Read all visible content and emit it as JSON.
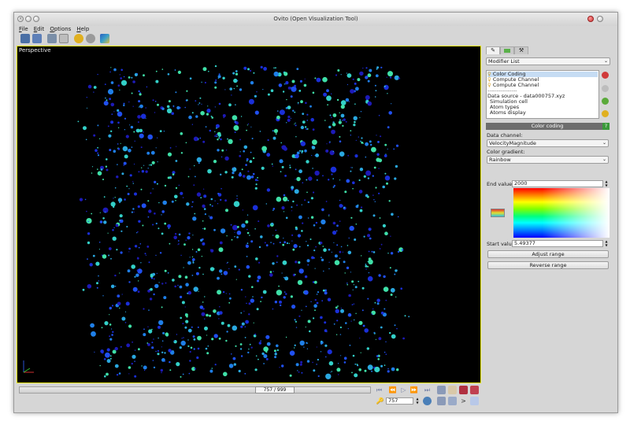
{
  "window": {
    "title": "Ovito (Open Visualization Tool)"
  },
  "menu": [
    "File",
    "Edit",
    "Options",
    "Help"
  ],
  "toolbar": [
    {
      "icon": "open-folder-icon",
      "color": "#4a6fa5"
    },
    {
      "icon": "save-icon",
      "color": "#5d7fb8"
    },
    {
      "icon": "import-icon",
      "color": "#7b8fa8"
    },
    {
      "icon": "export-icon",
      "color": "#a0a0a0"
    },
    {
      "icon": "lightbulb-icon",
      "color": "#e0b020"
    },
    {
      "icon": "render-icon",
      "color": "#8a8a8a"
    },
    {
      "icon": "render-frame-icon",
      "color": "#3aa0c8"
    }
  ],
  "viewport": {
    "label": "Perspective",
    "border_color": "#e6e600",
    "background": "#000000"
  },
  "command_panel": {
    "tabs": [
      "modify-tab-icon",
      "render-tab-icon",
      "utilities-tab-icon"
    ],
    "modifier_list": "Modifier List",
    "pipeline": [
      {
        "label": "Color Coding",
        "selected": true
      },
      {
        "label": "Compute Channel",
        "selected": false
      },
      {
        "label": "Compute Channel",
        "selected": false
      },
      {
        "label": "----------------",
        "selected": false
      },
      {
        "label": "Data source - data000757.xyz",
        "selected": false
      },
      {
        "label": "Simulation cell",
        "selected": false
      },
      {
        "label": "Atom types",
        "selected": false
      },
      {
        "label": "Atoms display",
        "selected": false
      }
    ],
    "color_coding": {
      "header": "Color coding",
      "help": "?",
      "data_channel_label": "Data channel:",
      "data_channel_value": "VelocityMagnitude",
      "gradient_label": "Color gradient:",
      "gradient_value": "Rainbow",
      "end_value_label": "End value:",
      "end_value": "2000",
      "start_value_label": "Start value:",
      "start_value": "5.49377",
      "adjust_range": "Adjust range",
      "reverse_range": "Reverse range"
    }
  },
  "animation": {
    "slider_label": "757 / 999",
    "frame": "757",
    "current_frame": 757,
    "total_frames": 999,
    "buttons": [
      "goto-start-icon",
      "previous-frame-icon",
      "play-icon",
      "next-frame-icon",
      "goto-end-icon"
    ]
  },
  "viewport_controls": [
    "zoom-icon",
    "pan-icon",
    "orbit-icon",
    "fov-icon",
    "zoom-region-icon",
    "zoom-extents-icon",
    "pick-orbit-center-icon",
    "maximize-viewport-icon"
  ]
}
